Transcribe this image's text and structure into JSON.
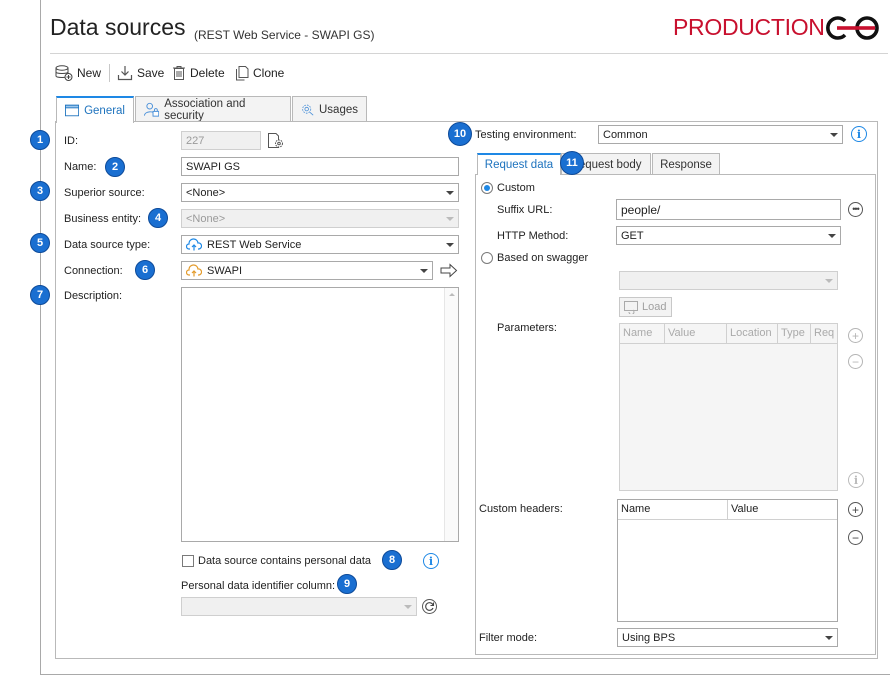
{
  "header": {
    "title": "Data sources",
    "subtitle": "(REST Web Service - SWAPI GS)",
    "environment": "PRODUCTION",
    "environment_color": "#c8102e"
  },
  "toolbar": {
    "new_label": "New",
    "save_label": "Save",
    "delete_label": "Delete",
    "clone_label": "Clone"
  },
  "tabs": [
    {
      "label": "General",
      "active": true,
      "icon": "window-icon"
    },
    {
      "label": "Association and security",
      "active": false,
      "icon": "user-lock-icon"
    },
    {
      "label": "Usages",
      "active": false,
      "icon": "gear-icon"
    }
  ],
  "general": {
    "id_label": "ID:",
    "id_value": "227",
    "name_label": "Name:",
    "name_value": "SWAPI GS",
    "superior_label": "Superior source:",
    "superior_value": "<None>",
    "business_label": "Business entity:",
    "business_value": "<None>",
    "type_label": "Data source type:",
    "type_value": "REST Web Service",
    "connection_label": "Connection:",
    "connection_value": "SWAPI",
    "description_label": "Description:",
    "description_value": "",
    "personal_checkbox_label": "Data source contains personal data",
    "personal_checked": false,
    "identifier_label": "Personal data identifier column:",
    "identifier_value": ""
  },
  "badges": {
    "b1": "1",
    "b2": "2",
    "b3": "3",
    "b4": "4",
    "b5": "5",
    "b6": "6",
    "b7": "7",
    "b8": "8",
    "b9": "9",
    "b10": "10",
    "b11": "11"
  },
  "testing": {
    "label": "Testing environment:",
    "value": "Common"
  },
  "right_tabs": [
    {
      "label": "Request data",
      "active": true
    },
    {
      "label": "Request body",
      "active": false
    },
    {
      "label": "Response",
      "active": false
    }
  ],
  "request": {
    "custom_label": "Custom",
    "custom_selected": true,
    "suffix_label": "Suffix URL:",
    "suffix_value": "people/",
    "method_label": "HTTP Method:",
    "method_value": "GET",
    "swagger_label": "Based on swagger",
    "swagger_selected": false,
    "swagger_value": "",
    "load_label": "Load",
    "parameters_label": "Parameters:",
    "parameter_columns": [
      "Name",
      "Value",
      "Location",
      "Type",
      "Req"
    ],
    "headers_label": "Custom headers:",
    "header_columns": [
      "Name",
      "Value"
    ],
    "filter_label": "Filter mode:",
    "filter_value": "Using BPS"
  }
}
